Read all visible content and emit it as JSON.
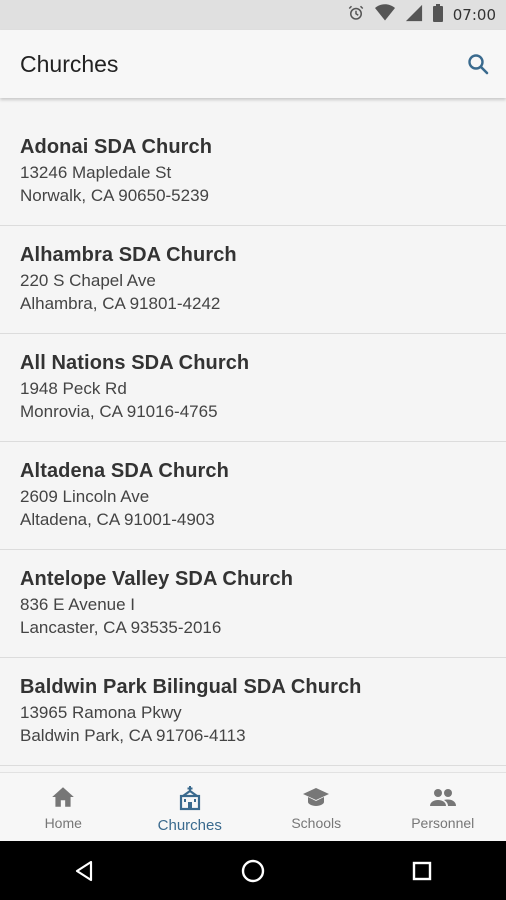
{
  "status_bar": {
    "time": "07:00",
    "icons": [
      "alarm-icon",
      "wifi-icon",
      "cell-signal-icon",
      "battery-icon"
    ]
  },
  "app_bar": {
    "title": "Churches",
    "search_icon": "search-icon"
  },
  "churches": [
    {
      "name": "Adonai SDA Church",
      "street": "13246 Mapledale St",
      "city": "Norwalk, CA 90650-5239"
    },
    {
      "name": "Alhambra SDA Church",
      "street": "220 S Chapel Ave",
      "city": "Alhambra, CA 91801-4242"
    },
    {
      "name": "All Nations SDA Church",
      "street": "1948 Peck Rd",
      "city": "Monrovia, CA 91016-4765"
    },
    {
      "name": "Altadena SDA Church",
      "street": "2609 Lincoln Ave",
      "city": "Altadena, CA 91001-4903"
    },
    {
      "name": "Antelope Valley SDA Church",
      "street": "836 E Avenue I",
      "city": "Lancaster, CA 93535-2016"
    },
    {
      "name": "Baldwin Park Bilingual SDA Church",
      "street": "13965 Ramona Pkwy",
      "city": "Baldwin Park, CA 91706-4113"
    }
  ],
  "bottom_nav": [
    {
      "label": "Home",
      "icon": "home-icon",
      "active": false
    },
    {
      "label": "Churches",
      "icon": "church-icon",
      "active": true
    },
    {
      "label": "Schools",
      "icon": "school-icon",
      "active": false
    },
    {
      "label": "Personnel",
      "icon": "people-icon",
      "active": false
    }
  ],
  "colors": {
    "accent": "#3a6a8e",
    "inactive": "#777777",
    "background": "#f5f5f5"
  }
}
